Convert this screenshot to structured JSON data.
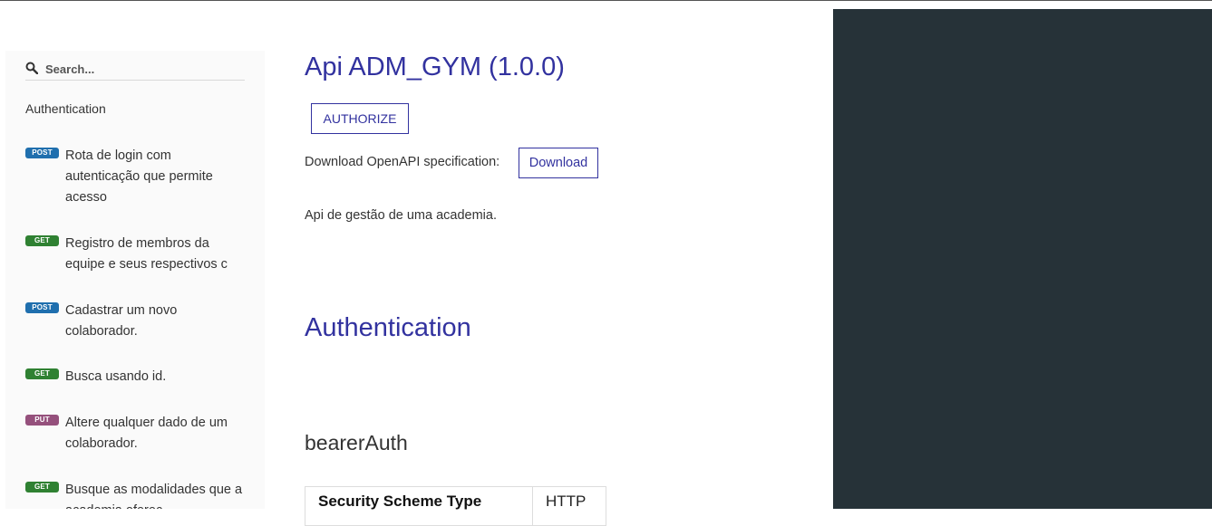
{
  "search": {
    "placeholder": "Search..."
  },
  "sidebar": {
    "section": "Authentication",
    "items": [
      {
        "method": "POST",
        "label": "Rota de login com autenticação que permite acesso"
      },
      {
        "method": "GET",
        "label": "Registro de membros da equipe e seus respectivos c"
      },
      {
        "method": "POST",
        "label": "Cadastrar um novo colaborador."
      },
      {
        "method": "GET",
        "label": "Busca usando id."
      },
      {
        "method": "PUT",
        "label": "Altere qualquer dado de um colaborador."
      },
      {
        "method": "GET",
        "label": "Busque as modalidades que a academia oferec"
      }
    ]
  },
  "main": {
    "title": "Api ADM_GYM (1.0.0)",
    "authorize_label": "AUTHORIZE",
    "download_label_text": "Download OpenAPI specification:",
    "download_button": "Download",
    "description": "Api de gestão de uma academia.",
    "auth_heading": "Authentication",
    "scheme_heading": "bearerAuth",
    "scheme_table": [
      {
        "key": "Security Scheme Type",
        "value": "HTTP"
      }
    ]
  },
  "colors": {
    "accent": "#32329f",
    "post": "#1f6fae",
    "get": "#2f8132",
    "put": "#95507c",
    "right_panel": "#263238"
  }
}
